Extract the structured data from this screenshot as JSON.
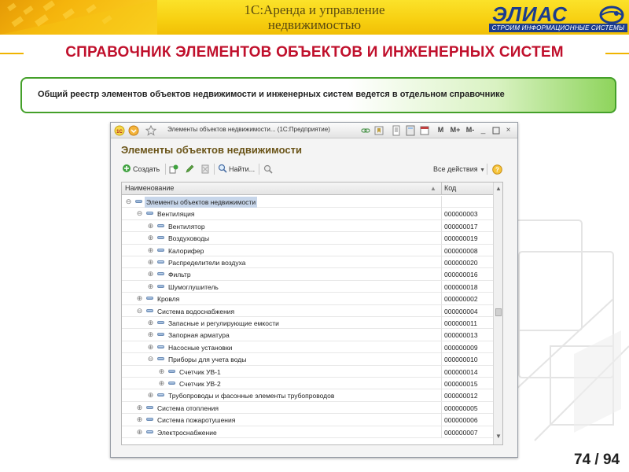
{
  "header": {
    "title_line1": "1С:Аренда и управление",
    "title_line2": "недвижимостью",
    "logo_text": "ЭЛИАС",
    "logo_tagline": "СТРОИМ ИНФОРМАЦИОННЫЕ СИСТЕМЫ"
  },
  "section_title": "СПРАВОЧНИК ЭЛЕМЕНТОВ ОБЪЕКТОВ И ИНЖЕНЕРНЫХ СИСТЕМ",
  "note": "Общий реестр элементов объектов недвижимости и инженерных систем ведется в отдельном справочнике",
  "window": {
    "title": "Элементы объектов недвижимости... (1С:Предприятие)",
    "form_title": "Элементы объектов недвижимости",
    "toolbar": {
      "create_label": "Создать",
      "find_label": "Найти...",
      "all_actions_label": "Все действия"
    },
    "titlebar_buttons": [
      "M",
      "M+",
      "M-"
    ],
    "columns": {
      "name": "Наименование",
      "code": "Код"
    },
    "rows": [
      {
        "name": "Элементы объектов недвижимости",
        "code": "",
        "level": 0,
        "toggle": "⊖",
        "selected": true
      },
      {
        "name": "Вентиляция",
        "code": "000000003",
        "level": 1,
        "toggle": "⊖"
      },
      {
        "name": "Вентилятор",
        "code": "000000017",
        "level": 2,
        "toggle": "⊕"
      },
      {
        "name": "Воздуховоды",
        "code": "000000019",
        "level": 2,
        "toggle": "⊕"
      },
      {
        "name": "Калорифер",
        "code": "000000008",
        "level": 2,
        "toggle": "⊕"
      },
      {
        "name": "Распределители воздуха",
        "code": "000000020",
        "level": 2,
        "toggle": "⊕"
      },
      {
        "name": "Фильтр",
        "code": "000000016",
        "level": 2,
        "toggle": "⊕"
      },
      {
        "name": "Шумоглушитель",
        "code": "000000018",
        "level": 2,
        "toggle": "⊕"
      },
      {
        "name": "Кровля",
        "code": "000000002",
        "level": 1,
        "toggle": "⊕"
      },
      {
        "name": "Система водоснабжения",
        "code": "000000004",
        "level": 1,
        "toggle": "⊖"
      },
      {
        "name": "Запасные и регулирующие емкости",
        "code": "000000011",
        "level": 2,
        "toggle": "⊕"
      },
      {
        "name": "Запорная арматура",
        "code": "000000013",
        "level": 2,
        "toggle": "⊕"
      },
      {
        "name": "Насосные установки",
        "code": "000000009",
        "level": 2,
        "toggle": "⊕"
      },
      {
        "name": "Приборы для учета воды",
        "code": "000000010",
        "level": 2,
        "toggle": "⊖"
      },
      {
        "name": "Счетчик УВ-1",
        "code": "000000014",
        "level": 3,
        "toggle": "⊕"
      },
      {
        "name": "Счетчик УВ-2",
        "code": "000000015",
        "level": 3,
        "toggle": "⊕"
      },
      {
        "name": "Трубопроводы и фасонные элементы трубопроводов",
        "code": "000000012",
        "level": 2,
        "toggle": "⊕"
      },
      {
        "name": "Система отопления",
        "code": "000000005",
        "level": 1,
        "toggle": "⊕"
      },
      {
        "name": "Система пожаротушения",
        "code": "000000006",
        "level": 1,
        "toggle": "⊕"
      },
      {
        "name": "Электроснабжение",
        "code": "000000007",
        "level": 1,
        "toggle": "⊕"
      }
    ]
  },
  "page_number": "74 / 94",
  "colors": {
    "banner": "#f7cf10",
    "section_title": "#c0102c",
    "note_border": "#44a02a",
    "logo": "#1b3c8e",
    "selection": "#c7d6ea"
  }
}
